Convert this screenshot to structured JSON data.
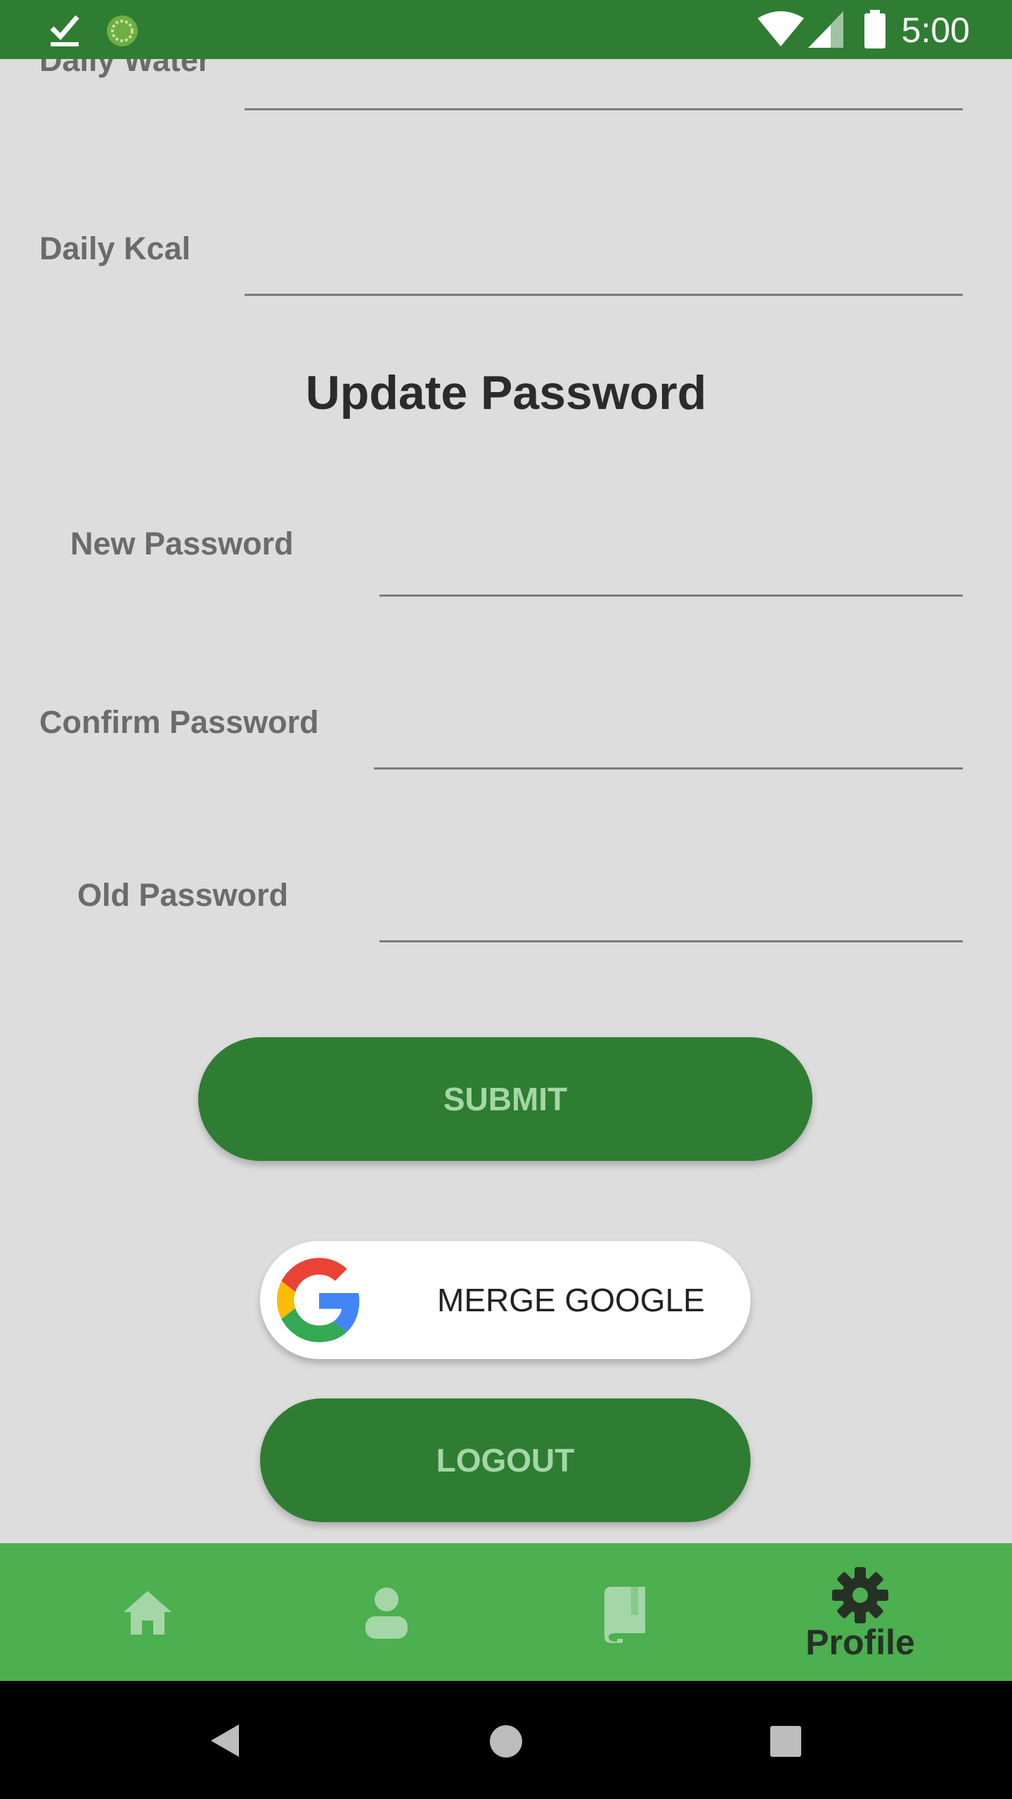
{
  "status_bar": {
    "time": "5:00",
    "icons": [
      "download-done-icon",
      "sync-icon",
      "wifi-icon",
      "signal-icon",
      "battery-icon"
    ]
  },
  "form": {
    "daily_water_label": "Daily Water",
    "daily_kcal_label": "Daily Kcal"
  },
  "update_password": {
    "title": "Update Password",
    "new_password_label": "New Password",
    "confirm_password_label": "Confirm Password",
    "old_password_label": "Old Password",
    "submit_label": "SUBMIT"
  },
  "merge_google_label": "MERGE GOOGLE",
  "logout_label": "LOGOUT",
  "bottom_nav": {
    "items": [
      {
        "icon": "home-icon",
        "label": ""
      },
      {
        "icon": "person-icon",
        "label": ""
      },
      {
        "icon": "book-icon",
        "label": ""
      },
      {
        "icon": "gear-icon",
        "label": "Profile",
        "selected": true
      }
    ]
  },
  "system_nav": [
    "back-icon",
    "home-circle-icon",
    "recents-icon"
  ],
  "colors": {
    "primary_dark": "#2e7d32",
    "primary": "#4caf50",
    "button_text": "#a5d6a7",
    "background": "#dddddd"
  }
}
